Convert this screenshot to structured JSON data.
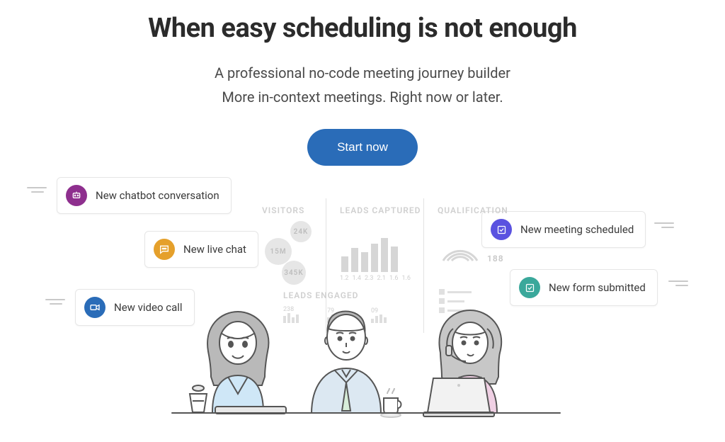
{
  "hero": {
    "headline": "When easy scheduling is not enough",
    "subtitle_line1": "A professional no-code meeting journey builder",
    "subtitle_line2": "More in-context meetings. Right now or later.",
    "cta_label": "Start now"
  },
  "cards": {
    "chatbot": "New chatbot conversation",
    "livechat": "New live chat",
    "video": "New video call",
    "meeting": "New meeting scheduled",
    "form": "New form submitted"
  },
  "dashboard": {
    "visitors_label": "VISITORS",
    "leads_captured_label": "LEADS CAPTURED",
    "qualification_label": "QUALIFICATION",
    "leads_engaged_label": "LEADS ENGAGED",
    "visitors_values": {
      "a": "24K",
      "b": "15M",
      "c": "345K"
    },
    "qualification_value": "188",
    "engaged_values": [
      "238",
      "79",
      "09"
    ],
    "leads_ticks": [
      "1.2",
      "1.4",
      "2.3",
      "2.1",
      "1.6",
      "1.6"
    ]
  },
  "colors": {
    "accent": "#2a6cb8",
    "chatbot": "#8e2f8e",
    "livechat": "#e5a02b",
    "video": "#2a6cb8",
    "meeting": "#5a52e0",
    "form": "#3aa89b"
  }
}
